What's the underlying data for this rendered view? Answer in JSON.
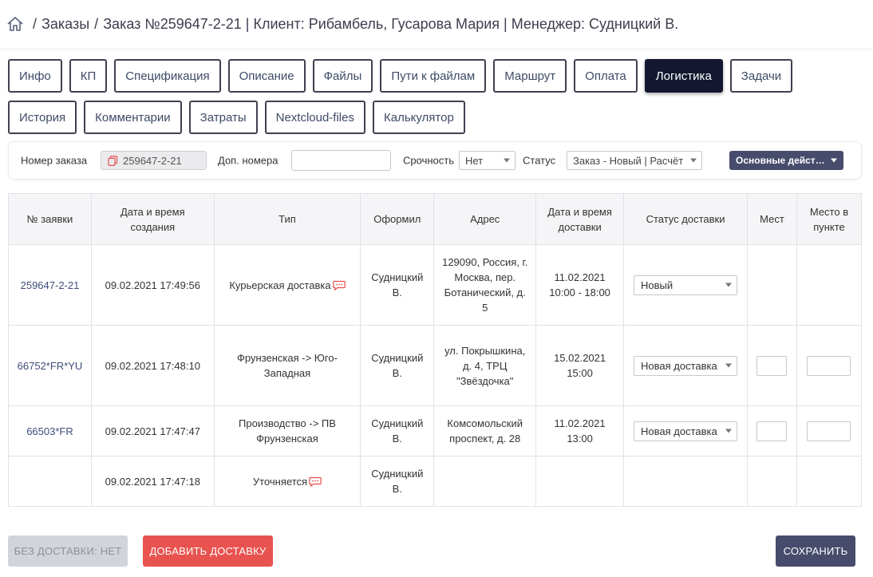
{
  "breadcrumb": {
    "home_icon": "home-icon",
    "sep1": "/",
    "orders": "Заказы",
    "sep2": "/",
    "current": "Заказ №259647-2-21 | Клиент: Рибамбель, Гусарова Мария | Менеджер: Судницкий В."
  },
  "tabs": {
    "row1": [
      "Инфо",
      "КП",
      "Спецификация",
      "Описание",
      "Файлы",
      "Пути к файлам",
      "Маршрут",
      "Оплата",
      "Логистика",
      "Задачи"
    ],
    "row2": [
      "История",
      "Комментарии",
      "Затраты",
      "Nextcloud-files",
      "Калькулятор"
    ],
    "active": "Логистика"
  },
  "filter": {
    "order_label": "Номер заказа",
    "order_value": "259647-2-21",
    "extra_label": "Доп. номера",
    "extra_value": "",
    "urgency_label": "Срочность",
    "urgency_value": "Нет",
    "status_label": "Статус",
    "status_value": "Заказ - Новый | Расчёт",
    "actions_label": "Основные действия"
  },
  "table": {
    "headers": [
      "№ заявки",
      "Дата и время создания",
      "Тип",
      "Оформил",
      "Адрес",
      "Дата и время доставки",
      "Статус доставки",
      "Мест",
      "Место в пункте"
    ],
    "rows": [
      {
        "id": "259647-2-21",
        "created": "09.02.2021 17:49:56",
        "type": "Курьерская доставка",
        "comment": true,
        "author": "Судницкий В.",
        "address": "129090, Россия, г. Москва, пер. Ботанический, д. 5",
        "delivery": "11.02.2021 10:00 - 18:00",
        "status": "Новый",
        "places": "",
        "place_point": ""
      },
      {
        "id": "66752*FR*YU",
        "created": "09.02.2021 17:48:10",
        "type": "Фрунзенская -> Юго-Западная",
        "comment": false,
        "author": "Судницкий В.",
        "address": "ул. Покрышкина, д. 4, ТРЦ \"Звёздочка\"",
        "delivery": "15.02.2021 15:00",
        "status": "Новая доставка",
        "places": "",
        "place_point": ""
      },
      {
        "id": "66503*FR",
        "created": "09.02.2021 17:47:47",
        "type": "Производство -> ПВ Фрунзенская",
        "comment": false,
        "author": "Судницкий В.",
        "address": "Комсомольский проспект, д. 28",
        "delivery": "11.02.2021 13:00",
        "status": "Новая доставка",
        "places": "",
        "place_point": ""
      },
      {
        "id": "",
        "created": "09.02.2021 17:47:18",
        "type": "Уточняется",
        "comment": true,
        "author": "Судницкий В.",
        "address": "",
        "delivery": "",
        "status": "",
        "places": "",
        "place_point": ""
      }
    ]
  },
  "buttons": {
    "no_delivery": "БЕЗ ДОСТАВКИ: НЕТ",
    "add_delivery": "ДОБАВИТЬ ДОСТАВКУ",
    "save": "СОХРАНИТЬ"
  },
  "colors": {
    "active_tab": "#131830",
    "primary": "#474c6c",
    "danger": "#e85350",
    "disabled": "#d2d4dc",
    "link": "#3e4d7a",
    "comment_icon": "#e84b4b"
  }
}
